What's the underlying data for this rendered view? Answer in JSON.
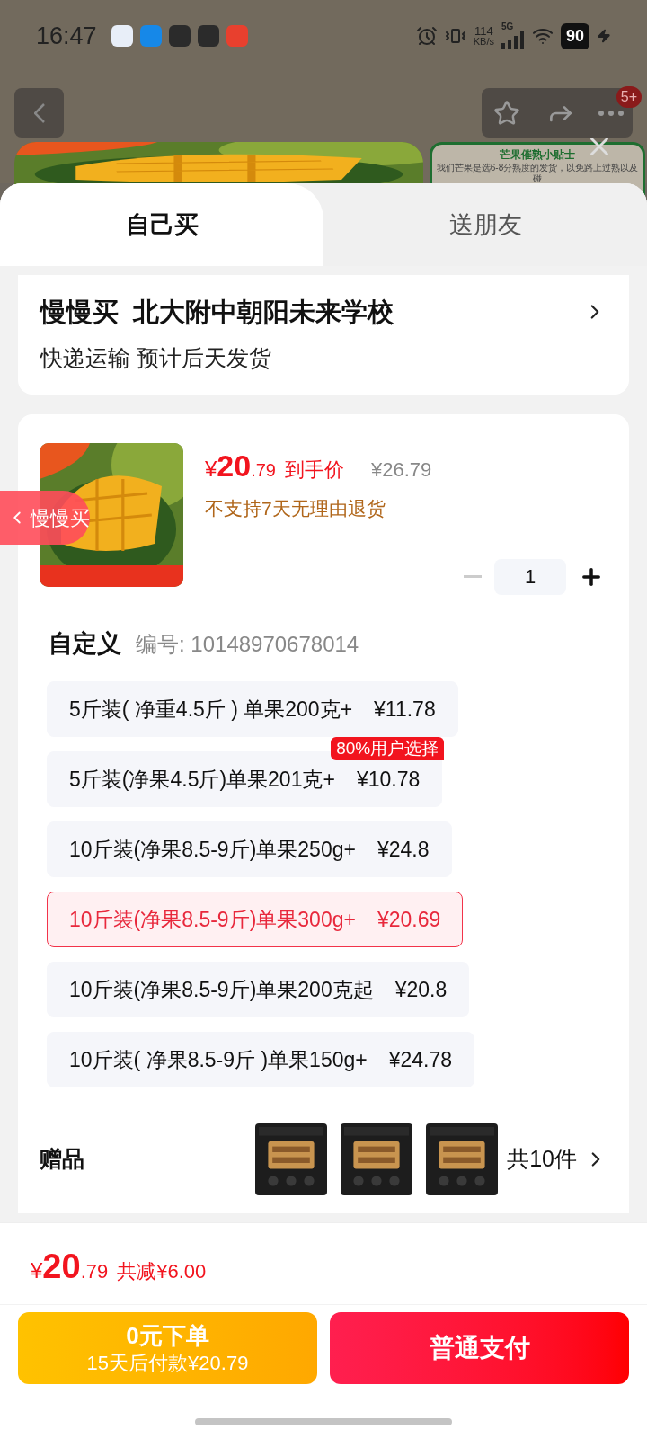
{
  "status_bar": {
    "time": "16:47",
    "net_speed": "114",
    "net_unit": "KB/s",
    "network": "5G",
    "battery": "90"
  },
  "background_page": {
    "badge": "5+",
    "tip_title": "芒果催熟小贴士",
    "tip_text": "我们芒果是选6-8分熟度的发货，以免路上过熟以及碰"
  },
  "tabs": [
    {
      "label": "自己买",
      "selected": true
    },
    {
      "label": "送朋友",
      "selected": false
    }
  ],
  "address": {
    "name": "慢慢买  北大附中朝阳未来学校",
    "shipping": "快递运输 预计后天发货"
  },
  "product": {
    "price_symbol": "¥",
    "price_int": "20",
    "price_dec": ".79",
    "price_label": "到手价",
    "original_price": "¥26.79",
    "return_note": "不支持7天无理由退货",
    "quantity": "1",
    "minus_disabled": true
  },
  "floating_tag": {
    "label": "慢慢买"
  },
  "spec": {
    "title": "自定义",
    "code": "编号: 10148970678014"
  },
  "options": [
    {
      "label": "5斤装( 净重4.5斤 ) 单果200克+",
      "price": "¥11.78",
      "selected": false
    },
    {
      "label": "5斤装(净果4.5斤)单果201克+",
      "price": "¥10.78",
      "selected": false,
      "badge": "80%用户选择"
    },
    {
      "label": "10斤装(净果8.5-9斤)单果250g+",
      "price": "¥24.8",
      "selected": false
    },
    {
      "label": "10斤装(净果8.5-9斤)单果300g+",
      "price": "¥20.69",
      "selected": true
    },
    {
      "label": "10斤装(净果8.5-9斤)单果200克起",
      "price": "¥20.8",
      "selected": false
    },
    {
      "label": "10斤装( 净果8.5-9斤 )单果150g+",
      "price": "¥24.78",
      "selected": false
    }
  ],
  "gifts": {
    "title": "赠品",
    "count": "共10件"
  },
  "summary": {
    "price_symbol": "¥",
    "price_int": "20",
    "price_dec": ".79",
    "discount": "共减¥6.00"
  },
  "buttons": [
    {
      "kind": "later",
      "title": "0元下单",
      "subtitle": "15天后付款¥20.79"
    },
    {
      "kind": "pay",
      "title": "普通支付"
    }
  ]
}
